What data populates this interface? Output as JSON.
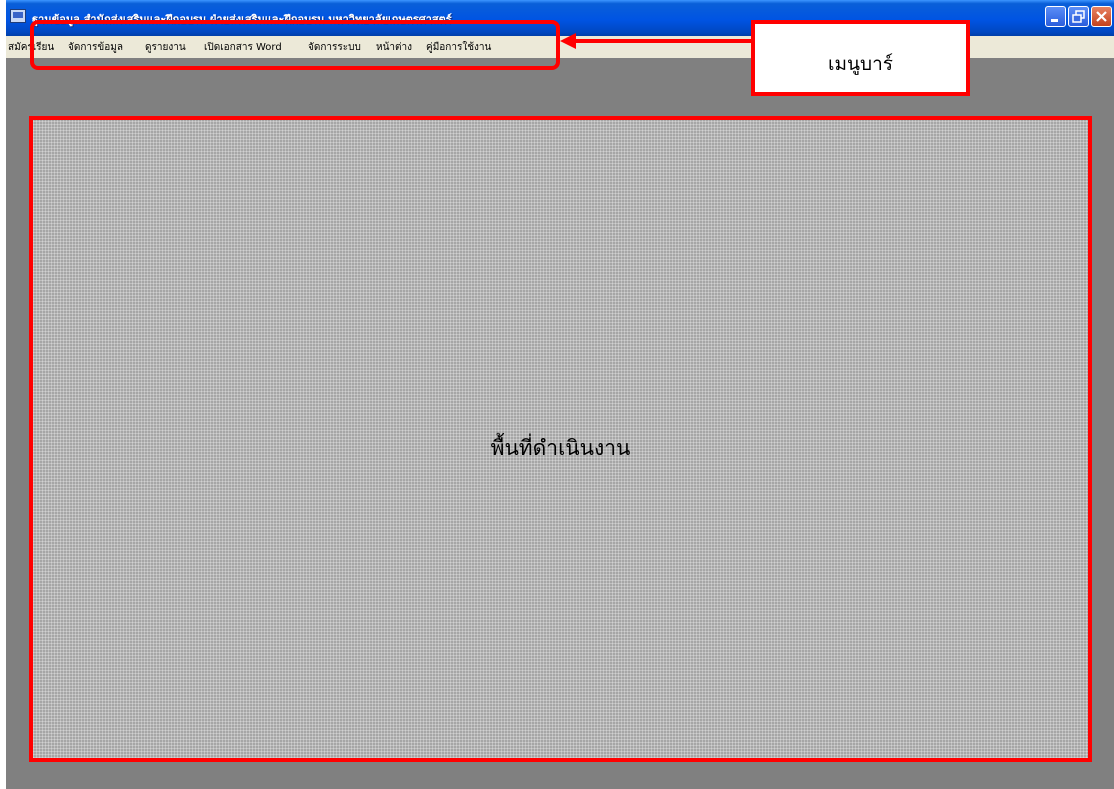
{
  "window": {
    "title": "ฐานข้อมูล สำนักส่งเสริมและฝึกอบรม ฝ่ายส่งเสริมและฝึกอบรม มหาวิทยาลัยเกษตรศาสตร์"
  },
  "title_controls": {
    "minimize": "minimize-icon",
    "maximize": "restore-icon",
    "close": "close-icon"
  },
  "menubar": {
    "items": [
      {
        "label": "สมัครเรียน"
      },
      {
        "label": "จัดการข้อมูล"
      },
      {
        "label": "ดูรายงาน"
      },
      {
        "label": "เปิดเอกสาร Word"
      },
      {
        "label": "จัดการระบบ"
      },
      {
        "label": "หน้าต่าง"
      },
      {
        "label": "คู่มือการใช้งาน"
      }
    ]
  },
  "annotations": {
    "menubar_callout": "เมนูบาร์",
    "workspace_label": "พื้นที่ดำเนินงาน",
    "highlight_color": "#ff0000"
  },
  "colors": {
    "titlebar": "#0054e3",
    "menubar": "#ece9d8",
    "mdi_background": "#808080"
  }
}
